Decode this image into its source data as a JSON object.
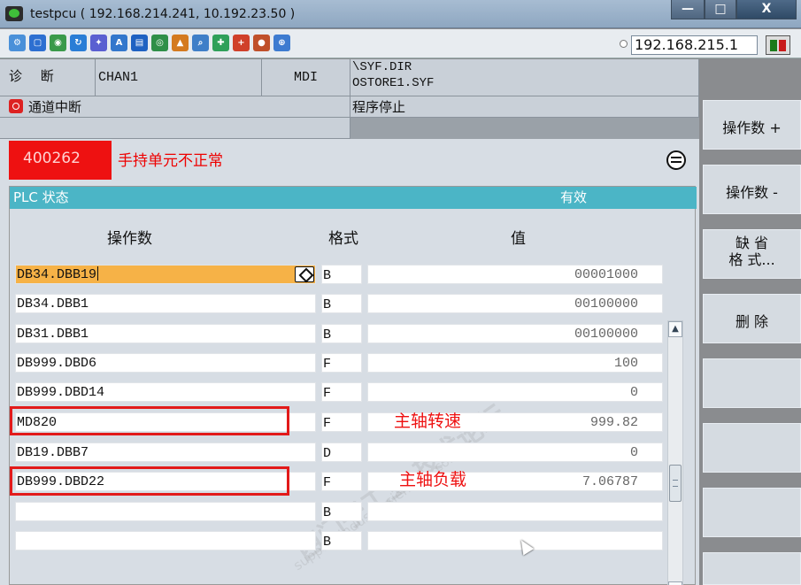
{
  "window": {
    "title": "testpcu ( 192.168.214.241, 10.192.23.50 )",
    "controls": {
      "minimize": "—",
      "maximize": "□",
      "close": "X"
    }
  },
  "toolbar": {
    "ip_address": "192.168.215.1",
    "icons": [
      "network-icon",
      "window-icon",
      "globe-icon",
      "refresh-icon",
      "puzzle-icon",
      "abc-icon",
      "book-icon",
      "search-globe-icon",
      "chart-icon",
      "magnify-icon",
      "tool-icon",
      "add-icon",
      "user-icon",
      "zoom-icon"
    ]
  },
  "header": {
    "area": "诊 断",
    "channel": "CHAN1",
    "mode": "MDI",
    "program_path": "\\SYF.DIR",
    "program_file": "OSTORE1.SYF",
    "channel_status": "通道中断",
    "program_status": "程序停止"
  },
  "alarm": {
    "number": "400262",
    "text": "手持单元不正常"
  },
  "plc": {
    "title": "PLC 状态",
    "validity": "有效",
    "col_operand": "操作数",
    "col_format": "格式",
    "col_value": "值",
    "rows": [
      {
        "addr": "DB34.DBB19",
        "fmt": "B",
        "val": "00001000"
      },
      {
        "addr": "DB34.DBB1",
        "fmt": "B",
        "val": "00100000"
      },
      {
        "addr": "DB31.DBB1",
        "fmt": "B",
        "val": "00100000"
      },
      {
        "addr": "DB999.DBD6",
        "fmt": "F",
        "val": "100"
      },
      {
        "addr": "DB999.DBD14",
        "fmt": "F",
        "val": "0"
      },
      {
        "addr": "MD820",
        "fmt": "F",
        "val": "999.82"
      },
      {
        "addr": "DB19.DBB7",
        "fmt": "D",
        "val": "0"
      },
      {
        "addr": "DB999.DBD22",
        "fmt": "F",
        "val": "7.06787"
      },
      {
        "addr": "",
        "fmt": "B",
        "val": ""
      },
      {
        "addr": "",
        "fmt": "B",
        "val": ""
      }
    ],
    "note_speed": "主轴转速",
    "note_load": "主轴负载"
  },
  "watermark": {
    "text": "西门子工业 技术论坛",
    "url": "support.industry.siemens.com/cs"
  },
  "softkeys": {
    "k1": "操作数 +",
    "k2": "操作数 -",
    "k3_l1": "缺 省",
    "k3_l2": "格 式...",
    "k4": "删 除"
  },
  "colors": {
    "title_bar": "#9bb2ca",
    "plc_title": "#4bb5c6",
    "alarm_red": "#ee1111",
    "active_cell": "#f6b247",
    "highlight": "#e21a1a"
  }
}
